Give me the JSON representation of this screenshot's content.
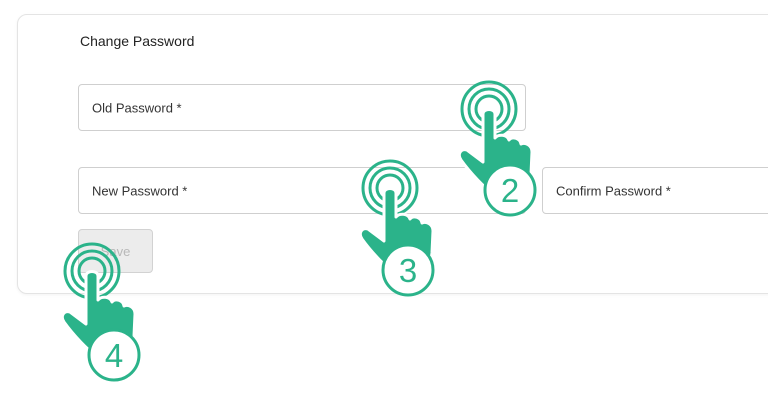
{
  "form": {
    "title": "Change Password",
    "old_password_label": "Old Password *",
    "new_password_label": "New Password *",
    "confirm_password_label": "Confirm Password *",
    "save_label": "Save"
  },
  "step_markers": {
    "old_password_step": "2",
    "new_password_step": "3",
    "save_step": "4"
  },
  "colors": {
    "accent": "#2bb38a",
    "accent_dark": "#1f8f6e"
  }
}
